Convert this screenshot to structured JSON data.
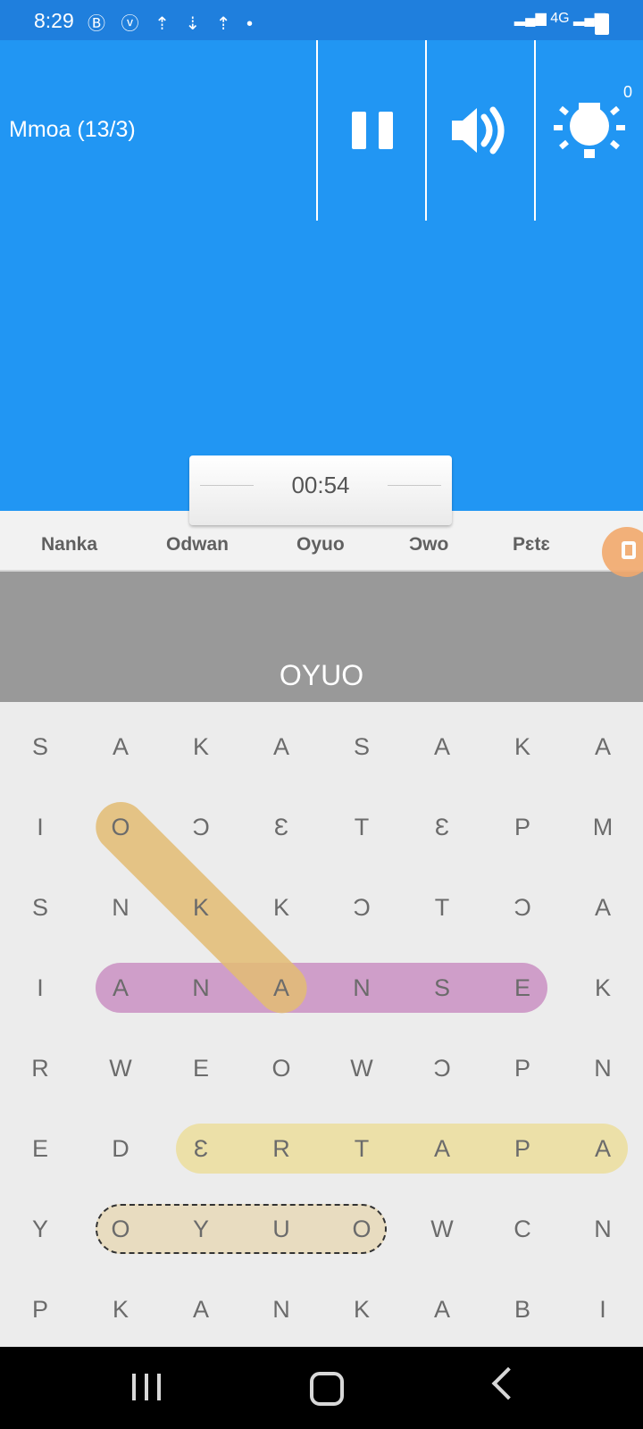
{
  "status_bar": {
    "time": "8:29",
    "icons": [
      "b-icon",
      "vpn-icon",
      "upload-icon",
      "download-icon",
      "upload-icon",
      "dot-icon"
    ],
    "network": "4G"
  },
  "toolbar": {
    "level_title": "Mmoa (13/3)",
    "score": "0",
    "buttons": [
      "pause",
      "sound",
      "hint"
    ]
  },
  "timer": {
    "value": "00:54"
  },
  "words": [
    "Nanka",
    "Odwan",
    "Oyuo",
    "Ɔwo",
    "Pɛtɛ"
  ],
  "current_word": "OYUO",
  "grid": [
    [
      "S",
      "A",
      "K",
      "A",
      "S",
      "A",
      "K",
      "A"
    ],
    [
      "I",
      "O",
      "Ɔ",
      "Ɛ",
      "T",
      "Ɛ",
      "P",
      "M"
    ],
    [
      "S",
      "N",
      "K",
      "K",
      "Ɔ",
      "T",
      "Ɔ",
      "A"
    ],
    [
      "I",
      "A",
      "N",
      "A",
      "N",
      "S",
      "E",
      "K"
    ],
    [
      "R",
      "W",
      "E",
      "O",
      "W",
      "Ɔ",
      "P",
      "N"
    ],
    [
      "E",
      "D",
      "Ɛ",
      "R",
      "T",
      "A",
      "P",
      "A"
    ],
    [
      "Y",
      "O",
      "Y",
      "U",
      "O",
      "W",
      "C",
      "N"
    ],
    [
      "P",
      "K",
      "A",
      "N",
      "K",
      "A",
      "B",
      "I"
    ]
  ],
  "highlights": [
    {
      "word": "ANANSE",
      "color": "#cf9ec9",
      "style": "solid",
      "from": [
        3,
        1
      ],
      "to": [
        3,
        6
      ]
    },
    {
      "word": "ƐRTAPA",
      "color": "#ece0a8",
      "style": "solid",
      "from": [
        5,
        2
      ],
      "to": [
        5,
        7
      ]
    },
    {
      "word": "OYUO",
      "color": "#e8dcc0",
      "style": "dashed",
      "from": [
        6,
        1
      ],
      "to": [
        6,
        4
      ]
    },
    {
      "word": "OKA",
      "color": "#e3bc73",
      "style": "solid",
      "from": [
        1,
        1
      ],
      "to": [
        3,
        3
      ]
    }
  ],
  "colors": {
    "primary": "#2196f3",
    "status_bar": "#1f7fdd",
    "grid_bg": "#ececec",
    "word_bar": "#999999"
  }
}
